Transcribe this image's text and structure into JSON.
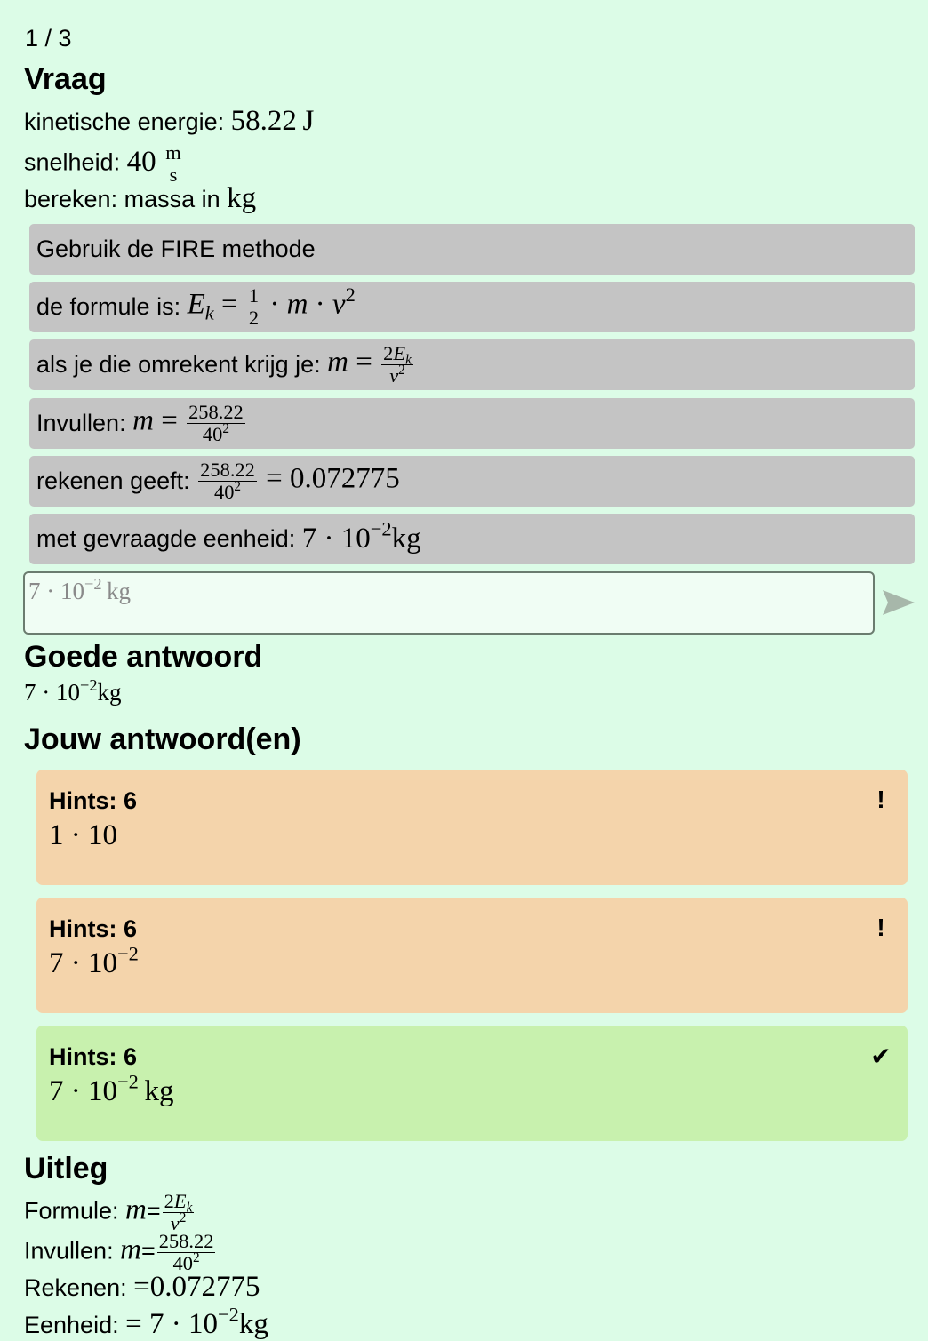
{
  "progress": "1 / 3",
  "question": {
    "title": "Vraag",
    "kinetic_label": "kinetische energie:",
    "kinetic_value": "58.22",
    "kinetic_unit": "J",
    "speed_label": "snelheid:",
    "speed_value": "40",
    "speed_unit_num": "m",
    "speed_unit_den": "s",
    "compute_label": "bereken: massa in",
    "compute_unit": "kg"
  },
  "hints": {
    "h1": "Gebruik de FIRE methode",
    "h2_label": "de formule is:",
    "h3_label": "als je die omrekent krijg je:",
    "h4_label": "Invullen:",
    "h4_num": "258.22",
    "h4_den_base": "40",
    "h5_label": "rekenen geeft:",
    "h5_num": "258.22",
    "h5_den_base": "40",
    "h5_result": "0.072775",
    "h6_label": "met gevraagde eenheid:",
    "h6_mant": "7",
    "h6_base": "10",
    "h6_exp": "−2",
    "h6_unit": "kg"
  },
  "answer_input": {
    "mant": "7",
    "base": "10",
    "exp": "−2",
    "unit": "kg"
  },
  "correct": {
    "title": "Goede antwoord",
    "mant": "7",
    "base": "10",
    "exp": "−2",
    "unit": "kg"
  },
  "attempts": {
    "title": "Jouw antwoord(en)",
    "items": [
      {
        "hints": "Hints: 6",
        "mant": "1",
        "base": "10",
        "status": "!"
      },
      {
        "hints": "Hints: 6",
        "mant": "7",
        "base": "10",
        "exp": "−2",
        "status": "!"
      },
      {
        "hints": "Hints: 6",
        "mant": "7",
        "base": "10",
        "exp": "−2",
        "unit": "kg",
        "status": "✔"
      }
    ]
  },
  "explanation": {
    "title": "Uitleg",
    "formula_label": "Formule:",
    "fill_label": "Invullen:",
    "fill_num": "258.22",
    "fill_den_base": "40",
    "calc_label": "Rekenen:",
    "calc_result": "0.072775",
    "unit_label": "Eenheid:",
    "unit_mant": "7",
    "unit_base": "10",
    "unit_exp": "−2",
    "unit_unit": "kg"
  },
  "colors": {
    "background": "#dcfce7",
    "hint_box": "#c4c4c4",
    "wrong_card": "#f4d4ab",
    "right_card": "#c8f1ae"
  },
  "icons": {
    "send": "send-arrow-icon",
    "warning": "exclamation-icon",
    "correct": "checkmark-icon"
  }
}
